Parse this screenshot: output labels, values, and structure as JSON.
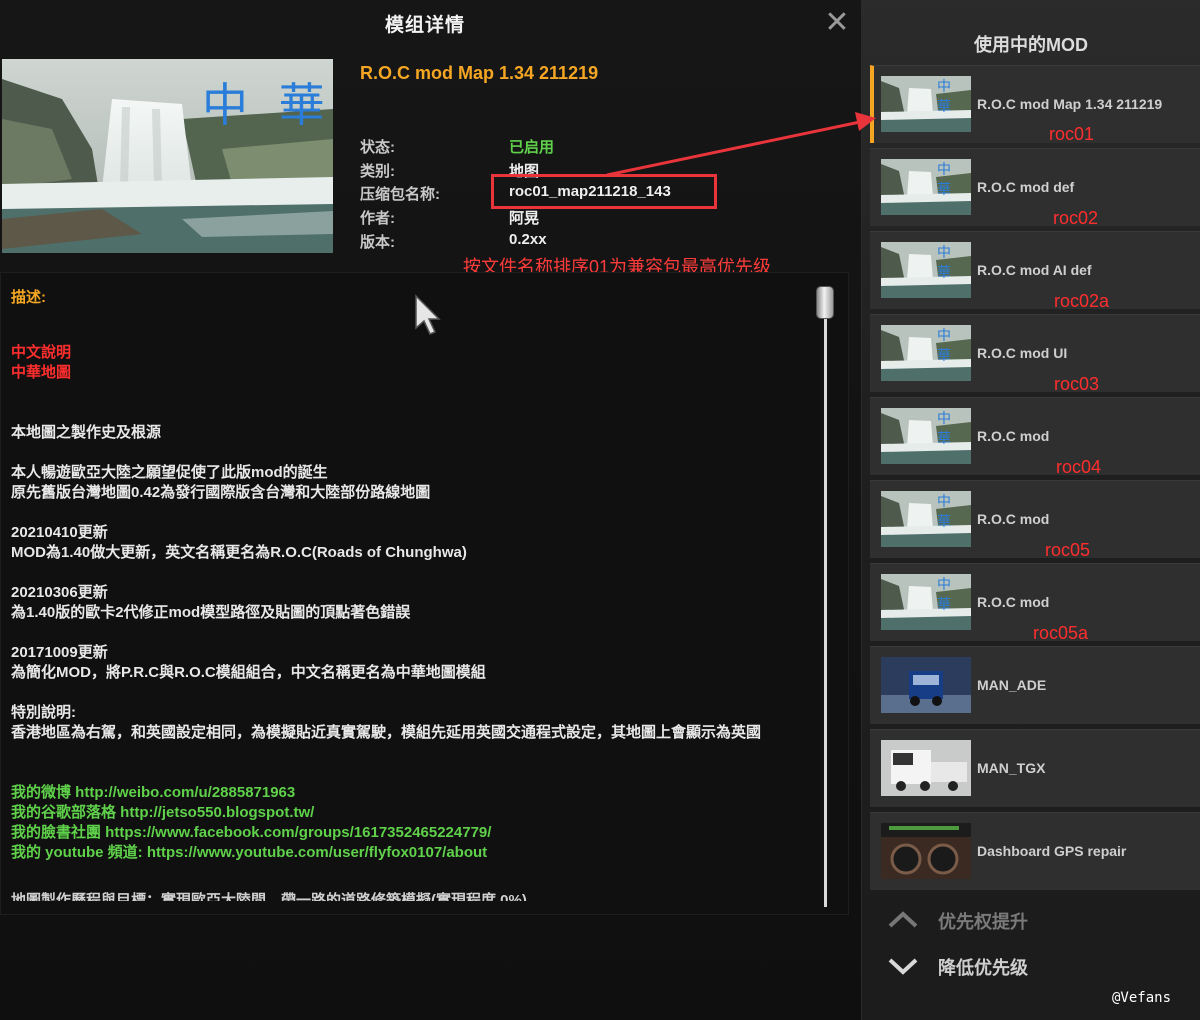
{
  "dialog": {
    "title": "模组详情",
    "close_glyph": "✕"
  },
  "mod": {
    "name": "R.O.C mod Map 1.34 211219",
    "image_text": "中 華",
    "meta": [
      {
        "label": "状态:",
        "value": "已启用",
        "color": "#5fd14a"
      },
      {
        "label": "类别:",
        "value": "地图"
      },
      {
        "label": "压缩包名称:",
        "value": "roc01_map211218_143"
      },
      {
        "label": "作者:",
        "value": "阿晃"
      },
      {
        "label": "版本:",
        "value": "0.2xx"
      }
    ]
  },
  "annotations": {
    "note": "按文件名称排序01为兼容包最高优先级",
    "color": "#e8343a"
  },
  "description": {
    "label": "描述:",
    "lines": [
      {
        "text": "中文說明",
        "style": "red"
      },
      {
        "text": "中華地圖",
        "style": "red"
      },
      {
        "text": "",
        "style": "gap"
      },
      {
        "text": "",
        "style": "gap"
      },
      {
        "text": "本地圖之製作史及根源"
      },
      {
        "text": "",
        "style": "gap"
      },
      {
        "text": "本人暢遊歐亞大陸之願望促使了此版mod的誕生"
      },
      {
        "text": "原先舊版台灣地圖0.42為發行國際版含台灣和大陸部份路線地圖"
      },
      {
        "text": "",
        "style": "gap"
      },
      {
        "text": "20210410更新"
      },
      {
        "text": "MOD為1.40做大更新，英文名稱更名為R.O.C(Roads of Chunghwa)"
      },
      {
        "text": "",
        "style": "gap"
      },
      {
        "text": "20210306更新"
      },
      {
        "text": "為1.40版的歐卡2代修正mod模型路徑及貼圖的頂點著色錯誤"
      },
      {
        "text": "",
        "style": "gap"
      },
      {
        "text": "20171009更新"
      },
      {
        "text": "為簡化MOD，將P.R.C與R.O.C模組組合，中文名稱更名為中華地圖模組"
      },
      {
        "text": "",
        "style": "gap"
      },
      {
        "text": "特別說明:"
      },
      {
        "text": "香港地區為右駕，和英國設定相同，為模擬貼近真實駕駛，模組先延用英國交通程式設定，其地圖上會顯示為英國"
      },
      {
        "text": "",
        "style": "gap"
      },
      {
        "text": "",
        "style": "gap"
      },
      {
        "text": "我的微博 http://weibo.com/u/2885871963",
        "style": "green"
      },
      {
        "text": "我的谷歌部落格 http://jetso550.blogspot.tw/",
        "style": "green"
      },
      {
        "text": "我的臉書社團 https://www.facebook.com/groups/1617352465224779/",
        "style": "green"
      },
      {
        "text": "我的 youtube 頻道: https://www.youtube.com/user/flyfox0107/about",
        "style": "green"
      }
    ],
    "cut_line": "地圖製作歷程與目標：實現歐亞大陸間，帶一路的道路修築模擬(實現程度 0%)"
  },
  "sidebar": {
    "title": "使用中的MOD",
    "items": [
      {
        "label": "R.O.C mod Map 1.34 211219",
        "thumb": "waterfall",
        "note": "roc01",
        "active": true
      },
      {
        "label": "R.O.C mod def",
        "thumb": "waterfall",
        "note": "roc02"
      },
      {
        "label": "R.O.C mod AI def",
        "thumb": "waterfall",
        "note": "roc02a"
      },
      {
        "label": "R.O.C mod UI",
        "thumb": "waterfall",
        "note": "roc03"
      },
      {
        "label": "R.O.C mod",
        "thumb": "waterfall",
        "note": "roc04"
      },
      {
        "label": "R.O.C mod",
        "thumb": "waterfall",
        "note": "roc05"
      },
      {
        "label": "R.O.C mod",
        "thumb": "waterfall",
        "note": "roc05a"
      },
      {
        "label": "MAN_ADE",
        "thumb": "truck-blue"
      },
      {
        "label": "MAN_TGX",
        "thumb": "truck-white"
      },
      {
        "label": "Dashboard GPS repair",
        "thumb": "dashboard"
      }
    ],
    "thumb_text": "中 華",
    "priority_up": "优先权提升",
    "priority_down": "降低优先级"
  },
  "watermark": "@Vefans",
  "colors": {
    "accent": "#f5a623",
    "enabled": "#5fd14a",
    "annotation": "#ff2e2e"
  }
}
